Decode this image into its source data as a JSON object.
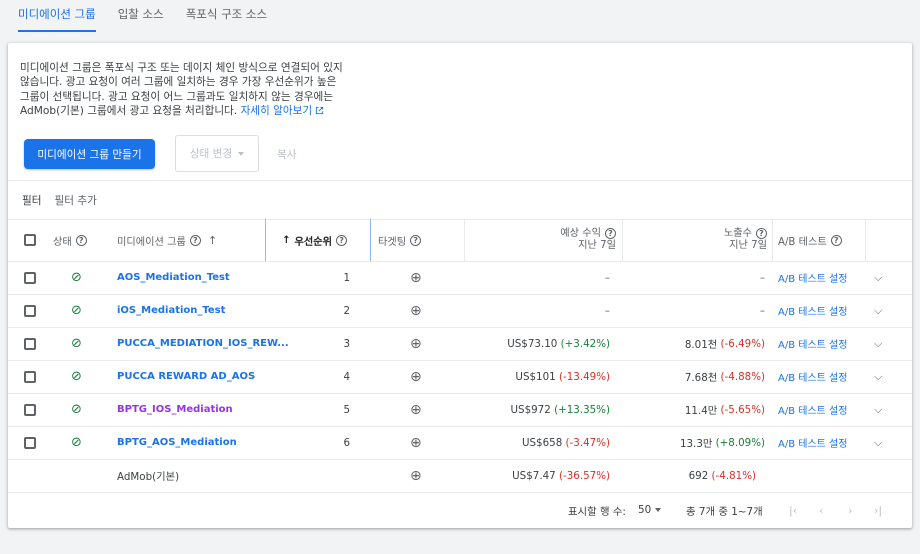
{
  "tabs": [
    {
      "label": "미디에이션 그룹",
      "active": true
    },
    {
      "label": "입찰 소스",
      "active": false
    },
    {
      "label": "폭포식 구조 소스",
      "active": false
    }
  ],
  "description": {
    "line1": "미디에이션 그룹은 폭포식 구조 또는 데이지 체인 방식으로 연결되어 있지",
    "line2": "않습니다. 광고 요청이 여러 그룹에 일치하는 경우 가장 우선순위가 높은",
    "line3": "그룹이 선택됩니다. 광고 요청이 어느 그룹과도 일치하지 않는 경우에는",
    "line4": "AdMob(기본) 그룹에서 광고 요청을 처리합니다.",
    "learn_more": "자세히 알아보기"
  },
  "actions": {
    "create": "미디에이션 그룹 만들기",
    "change_state": "상태 변경",
    "copy": "복사"
  },
  "filter": {
    "label": "필터",
    "add": "필터 추가"
  },
  "table": {
    "headers": {
      "state": "상태",
      "group": "미디에이션 그룹",
      "priority": "우선순위",
      "targeting": "타겟팅",
      "revenue_line1": "예상 수익",
      "revenue_line2": "지난 7일",
      "impressions_line1": "노출수",
      "impressions_line2": "지난 7일",
      "ab": "A/B 테스트"
    },
    "rows": [
      {
        "name": "AOS_Mediation_Test",
        "priority": "1",
        "revenue": "–",
        "revenue_change": "",
        "impressions": "–",
        "impressions_change": "",
        "ab": "A/B 테스트 설정"
      },
      {
        "name": "iOS_Mediation_Test",
        "priority": "2",
        "revenue": "–",
        "revenue_change": "",
        "impressions": "–",
        "impressions_change": "",
        "ab": "A/B 테스트 설정"
      },
      {
        "name": "PUCCA_MEDIATION_IOS_REW...",
        "priority": "3",
        "revenue": "US$73.10",
        "revenue_change": "(+3.42%)",
        "impressions": "8.01천",
        "impressions_change": "(-6.49%)",
        "ab": "A/B 테스트 설정"
      },
      {
        "name": "PUCCA REWARD AD_AOS",
        "priority": "4",
        "revenue": "US$101",
        "revenue_change": "(-13.49%)",
        "impressions": "7.68천",
        "impressions_change": "(-4.88%)",
        "ab": "A/B 테스트 설정"
      },
      {
        "name": "BPTG_IOS_Mediation",
        "priority": "5",
        "revenue": "US$972",
        "revenue_change": "(+13.35%)",
        "impressions": "11.4만",
        "impressions_change": "(-5.65%)",
        "ab": "A/B 테스트 설정"
      },
      {
        "name": "BPTG_AOS_Mediation",
        "priority": "6",
        "revenue": "US$658",
        "revenue_change": "(-3.47%)",
        "impressions": "13.3만",
        "impressions_change": "(+8.09%)",
        "ab": "A/B 테스트 설정"
      }
    ],
    "default_row": {
      "name": "AdMob(기본)",
      "revenue": "US$7.47",
      "revenue_change": "(-36.57%)",
      "impressions": "692",
      "impressions_change": "(-4.81%)"
    }
  },
  "footer": {
    "rows_label": "표시할 행 수:",
    "rows_value": "50",
    "range": "총 7개 중 1~7개"
  },
  "colors": {
    "accent": "#1a73e8",
    "positive": "#188038",
    "negative": "#d93025",
    "visited": "#9334e6"
  }
}
